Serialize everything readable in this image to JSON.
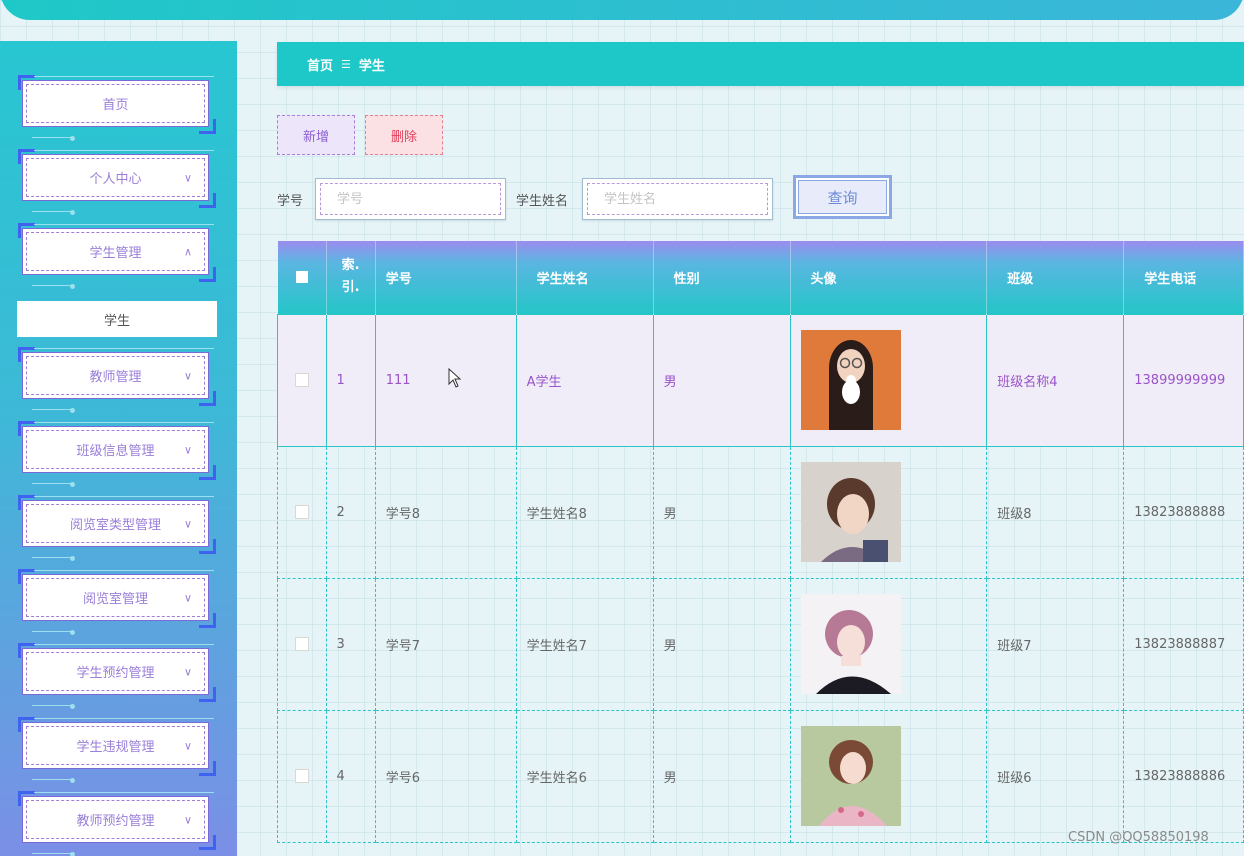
{
  "breadcrumb": {
    "home": "首页",
    "separator": "☰",
    "current": "学生"
  },
  "sidebar": {
    "items": [
      {
        "label": "首页",
        "expandable": false
      },
      {
        "label": "个人中心",
        "expandable": true
      },
      {
        "label": "学生管理",
        "expandable": true,
        "expanded": true
      },
      {
        "label": "教师管理",
        "expandable": true
      },
      {
        "label": "班级信息管理",
        "expandable": true
      },
      {
        "label": "阅览室类型管理",
        "expandable": true
      },
      {
        "label": "阅览室管理",
        "expandable": true
      },
      {
        "label": "学生预约管理",
        "expandable": true
      },
      {
        "label": "学生违规管理",
        "expandable": true
      },
      {
        "label": "教师预约管理",
        "expandable": true
      }
    ],
    "submenu": {
      "label": "学生"
    },
    "chevron_down": "∨",
    "chevron_up": "∧"
  },
  "actions": {
    "add_label": "新增",
    "delete_label": "删除"
  },
  "search": {
    "field1": {
      "label": "学号",
      "placeholder": "学号",
      "value": ""
    },
    "field2": {
      "label": "学生姓名",
      "placeholder": "学生姓名",
      "value": ""
    },
    "query_label": "查询"
  },
  "table": {
    "headers": {
      "index": "索.\n引.",
      "student_id": "学号",
      "name": "学生姓名",
      "gender": "性别",
      "avatar": "头像",
      "class": "班级",
      "phone": "学生电话"
    },
    "rows": [
      {
        "index": "1",
        "student_id": "111",
        "name": "A学生",
        "gender": "男",
        "class": "班级名称4",
        "phone": "13899999999",
        "avatar_icon": "girl-glasses-photo"
      },
      {
        "index": "2",
        "student_id": "学号8",
        "name": "学生姓名8",
        "gender": "男",
        "class": "班级8",
        "phone": "13823888888",
        "avatar_icon": "boy-portrait-photo"
      },
      {
        "index": "3",
        "student_id": "学号7",
        "name": "学生姓名7",
        "gender": "男",
        "class": "班级7",
        "phone": "13823888887",
        "avatar_icon": "girl-pink-hair-photo"
      },
      {
        "index": "4",
        "student_id": "学号6",
        "name": "学生姓名6",
        "gender": "男",
        "class": "班级6",
        "phone": "13823888886",
        "avatar_icon": "girl-floral-photo"
      }
    ]
  },
  "watermark": "CSDN @QQ58850198",
  "colors": {
    "teal": "#1ec8c8",
    "purple": "#9a54c8",
    "sidebar_bottom": "#7b8fe6"
  }
}
